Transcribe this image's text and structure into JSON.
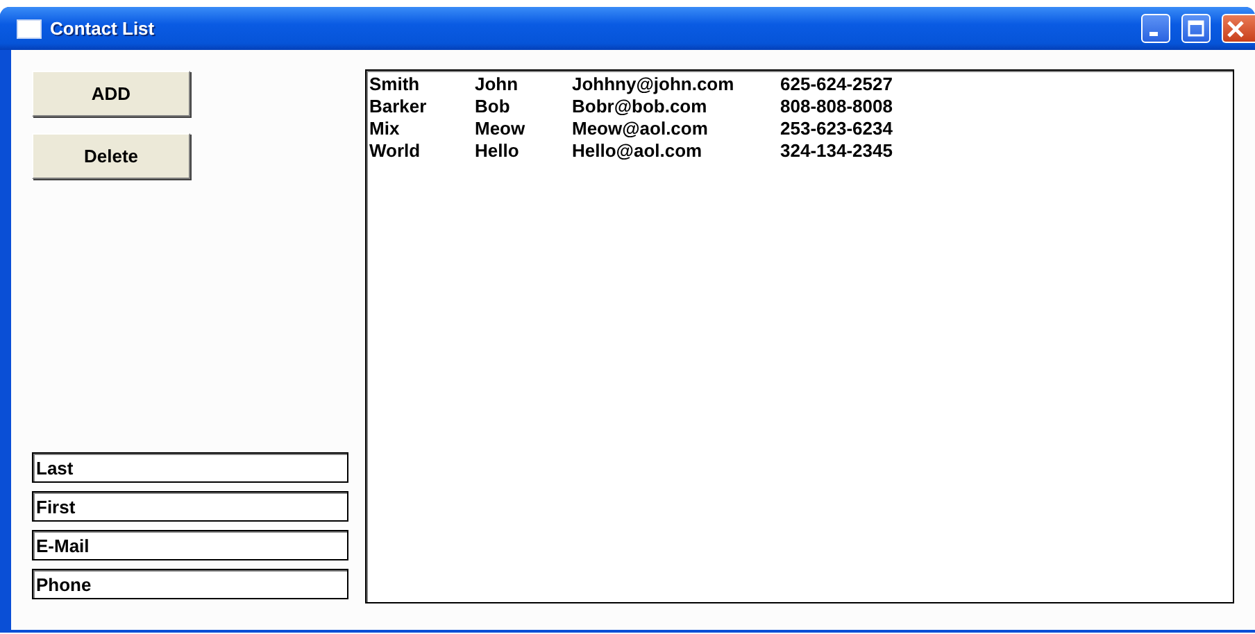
{
  "window": {
    "title": "Contact List"
  },
  "buttons": [
    {
      "label": "ADD"
    },
    {
      "label": "Delete"
    }
  ],
  "contacts": [
    {
      "last": "Smith",
      "first": "John",
      "email": "Johhny@john.com",
      "phone": "625-624-2527"
    },
    {
      "last": "Barker",
      "first": "Bob",
      "email": "Bobr@bob.com",
      "phone": "808-808-8008"
    },
    {
      "last": "Mix",
      "first": "Meow",
      "email": "Meow@aol.com",
      "phone": "253-623-6234"
    },
    {
      "last": "World",
      "first": "Hello",
      "email": "Hello@aol.com",
      "phone": "324-134-2345"
    }
  ],
  "fields": [
    {
      "value": "Last"
    },
    {
      "value": "First"
    },
    {
      "value": "E-Mail"
    },
    {
      "value": "Phone"
    }
  ]
}
